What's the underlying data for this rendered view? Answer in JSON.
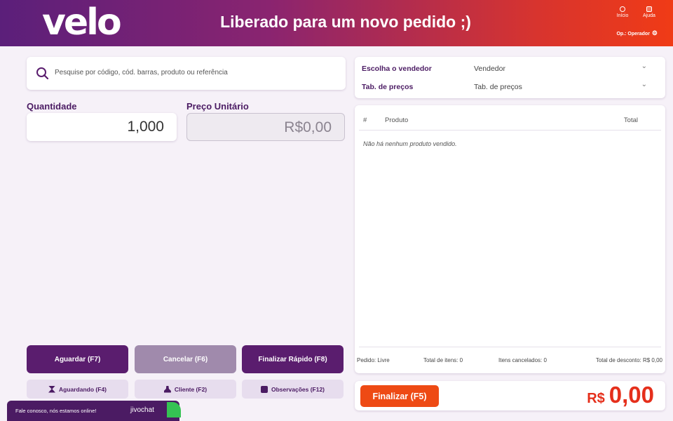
{
  "header": {
    "logo": "velo",
    "title": "Liberado para um novo pedido ;)",
    "inicio_label": "Início",
    "ajuda_label": "Ajuda",
    "operator_label": "Op.: Operador"
  },
  "search": {
    "placeholder": "Pesquise por código, cód. barras, produto ou referência"
  },
  "quantity": {
    "label": "Quantidade",
    "value": "1,000"
  },
  "unit_price": {
    "label": "Preço Unitário",
    "value": "R$0,00"
  },
  "actions": {
    "aguardar": "Aguardar (F7)",
    "cancelar": "Cancelar (F6)",
    "finalizar_rapido": "Finalizar Rápido (F8)",
    "aguardando": "Aguardando (F4)",
    "cliente": "Cliente (F2)",
    "observacoes": "Observações (F12)"
  },
  "seller": {
    "label": "Escolha o vendedor",
    "value": "Vendedor",
    "price_table_label": "Tab. de preços",
    "price_table_value": "Tab. de preços"
  },
  "table": {
    "columns": [
      "#",
      "Produto",
      "Total"
    ],
    "empty_message": "Não há nenhum produto vendido."
  },
  "order_footer": {
    "pedido": "Pedido: Livre",
    "total_itens": "Total de itens: 0",
    "itens_cancelados": "Itens cancelados: 0",
    "total_desconto": "Total de desconto: R$ 0,00"
  },
  "total": {
    "finalizar_label": "Finalizar (F5)",
    "currency": "R$",
    "amount": "0,00"
  },
  "chat": {
    "message": "Fale conosco, nós estamos online!",
    "brand": "jivochat"
  },
  "colors": {
    "brand_purple": "#5a1d6e",
    "accent_orange": "#ee4a14",
    "total_red": "#e52f1b"
  }
}
